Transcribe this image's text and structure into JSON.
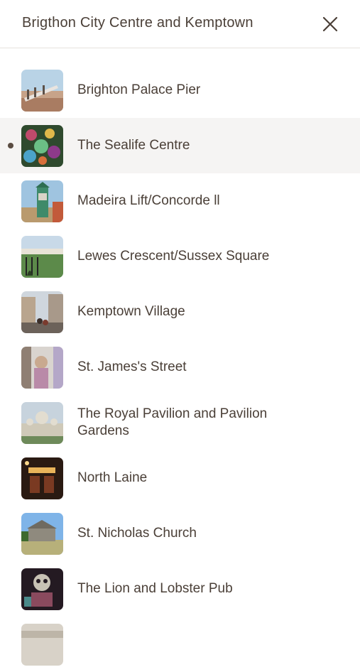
{
  "header": {
    "title": "Brigthon City Centre and Kemptown",
    "close_icon": "close-icon"
  },
  "stops": [
    {
      "label": "Brighton Palace Pier",
      "thumb": "pier-photo",
      "active": false
    },
    {
      "label": "The Sealife Centre",
      "thumb": "sealife-photo",
      "active": true
    },
    {
      "label": "Madeira Lift/Concorde ll",
      "thumb": "madeira-lift-photo",
      "active": false
    },
    {
      "label": "Lewes Crescent/Sussex Square",
      "thumb": "lewes-crescent-photo",
      "active": false
    },
    {
      "label": "Kemptown Village",
      "thumb": "kemptown-village-photo",
      "active": false
    },
    {
      "label": "St. James's Street",
      "thumb": "st-james-street-photo",
      "active": false
    },
    {
      "label": "The Royal Pavilion and Pavilion Gardens",
      "thumb": "royal-pavilion-photo",
      "active": false
    },
    {
      "label": "North Laine",
      "thumb": "north-laine-photo",
      "active": false
    },
    {
      "label": "St. Nicholas Church",
      "thumb": "st-nicholas-church-photo",
      "active": false
    },
    {
      "label": "The Lion and Lobster Pub",
      "thumb": "lion-lobster-pub-photo",
      "active": false
    },
    {
      "label": "",
      "thumb": "next-stop-photo",
      "active": false
    }
  ]
}
